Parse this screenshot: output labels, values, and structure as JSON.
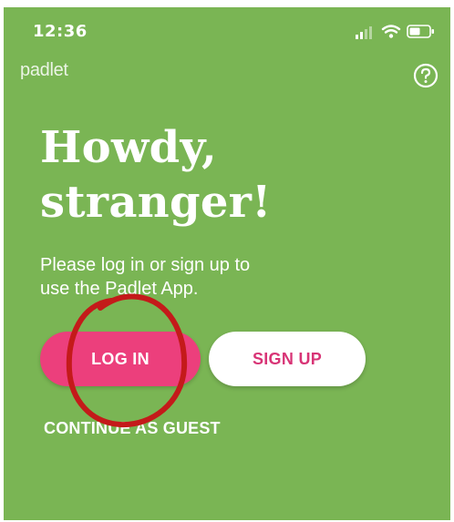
{
  "status_bar": {
    "time": "12:36"
  },
  "header": {
    "brand": "padlet",
    "help_icon": "question-circle-icon"
  },
  "main": {
    "headline_line1": "Howdy,",
    "headline_line2": "stranger!",
    "subtitle_line1": "Please log in or sign up to",
    "subtitle_line2": "use the Padlet App.",
    "login_label": "LOG IN",
    "signup_label": "SIGN UP",
    "guest_label": "CONTINUE AS GUEST"
  },
  "colors": {
    "background": "#7ab554",
    "login_button": "#ec3f7c",
    "signup_text": "#d83476",
    "annotation_circle": "#c41a1a"
  }
}
